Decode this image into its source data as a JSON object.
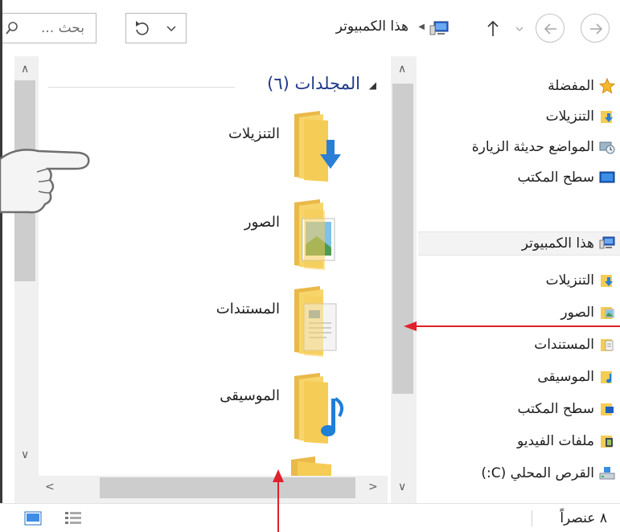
{
  "toolbar": {
    "search_placeholder": "بحث ...",
    "address_text": "هذا الكمبيوتر",
    "refresh_icon": "refresh-icon",
    "up_icon": "up-arrow-icon",
    "back_icon": "back-arrow-icon",
    "forward_icon": "forward-arrow-icon"
  },
  "content": {
    "group_label": "المجلدات (٦)",
    "folders": [
      {
        "label": "التنزيلات",
        "icon": "downloads-folder-icon"
      },
      {
        "label": "الصور",
        "icon": "pictures-folder-icon"
      },
      {
        "label": "المستندات",
        "icon": "documents-folder-icon"
      },
      {
        "label": "الموسيقى",
        "icon": "music-folder-icon"
      }
    ]
  },
  "navigation": {
    "favorites": [
      {
        "label": "المفضلة",
        "icon": "star-icon"
      },
      {
        "label": "التنزيلات",
        "icon": "downloads-folder-icon"
      },
      {
        "label": "المواضع حديثة الزيارة",
        "icon": "recent-places-icon"
      },
      {
        "label": "سطح المكتب",
        "icon": "desktop-icon"
      }
    ],
    "this_pc": [
      {
        "label": "هذا الكمبيوتر",
        "icon": "computer-icon"
      },
      {
        "label": "التنزيلات",
        "icon": "downloads-folder-icon"
      },
      {
        "label": "الصور",
        "icon": "pictures-folder-icon"
      },
      {
        "label": "المستندات",
        "icon": "documents-folder-icon"
      },
      {
        "label": "الموسيقى",
        "icon": "music-folder-icon"
      },
      {
        "label": "سطح المكتب",
        "icon": "desktop-folder-icon"
      },
      {
        "label": "ملفات الفيديو",
        "icon": "videos-folder-icon"
      },
      {
        "label": "القرص المحلي (C:)",
        "icon": "drive-icon"
      }
    ]
  },
  "status": {
    "item_count": "٨ عنصراً"
  },
  "colors": {
    "annotation_red": "#e0212b",
    "group_header_blue": "#1f3a8a",
    "folder_yellow": "#f7d56b"
  }
}
